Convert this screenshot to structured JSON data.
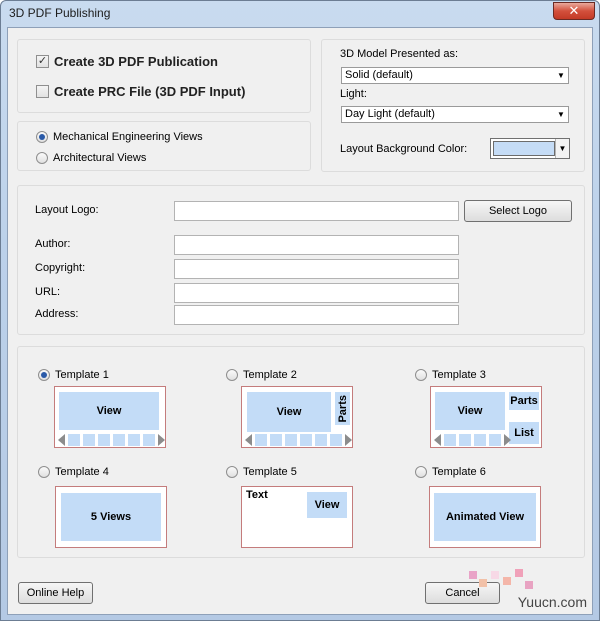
{
  "window": {
    "title": "3D PDF Publishing",
    "close_glyph": "✕"
  },
  "options": {
    "create_3d_pdf": {
      "label": "Create 3D PDF Publication",
      "checked": true
    },
    "create_prc": {
      "label": "Create PRC File (3D PDF Input)",
      "checked": false
    }
  },
  "views": {
    "mechanical": {
      "label": "Mechanical Engineering Views",
      "selected": true
    },
    "architectural": {
      "label": "Architectural Views",
      "selected": false
    }
  },
  "model": {
    "presented_label": "3D Model Presented as:",
    "presented_value": "Solid (default)",
    "light_label": "Light:",
    "light_value": "Day Light (default)",
    "bg_color_label": "Layout Background Color:",
    "bg_color": "#c5dcf6"
  },
  "info": {
    "logo_label": "Layout Logo:",
    "select_logo": "Select Logo",
    "author_label": "Author:",
    "copyright_label": "Copyright:",
    "url_label": "URL:",
    "address_label": "Address:",
    "logo_value": "",
    "author_value": "",
    "copyright_value": "",
    "url_value": "",
    "address_value": ""
  },
  "templates": [
    {
      "label": "Template 1",
      "selected": true,
      "view": "View"
    },
    {
      "label": "Template 2",
      "selected": false,
      "view": "View",
      "parts": "Parts"
    },
    {
      "label": "Template 3",
      "selected": false,
      "view": "View",
      "parts": "Parts",
      "list": "List"
    },
    {
      "label": "Template 4",
      "selected": false,
      "view": "5 Views"
    },
    {
      "label": "Template 5",
      "selected": false,
      "view": "View",
      "text": "Text"
    },
    {
      "label": "Template 6",
      "selected": false,
      "view": "Animated View"
    }
  ],
  "buttons": {
    "help": "Online Help",
    "cancel": "Cancel"
  },
  "watermark": "Yuucn.com",
  "glyphs": {
    "check": "✓",
    "down": "▼"
  }
}
